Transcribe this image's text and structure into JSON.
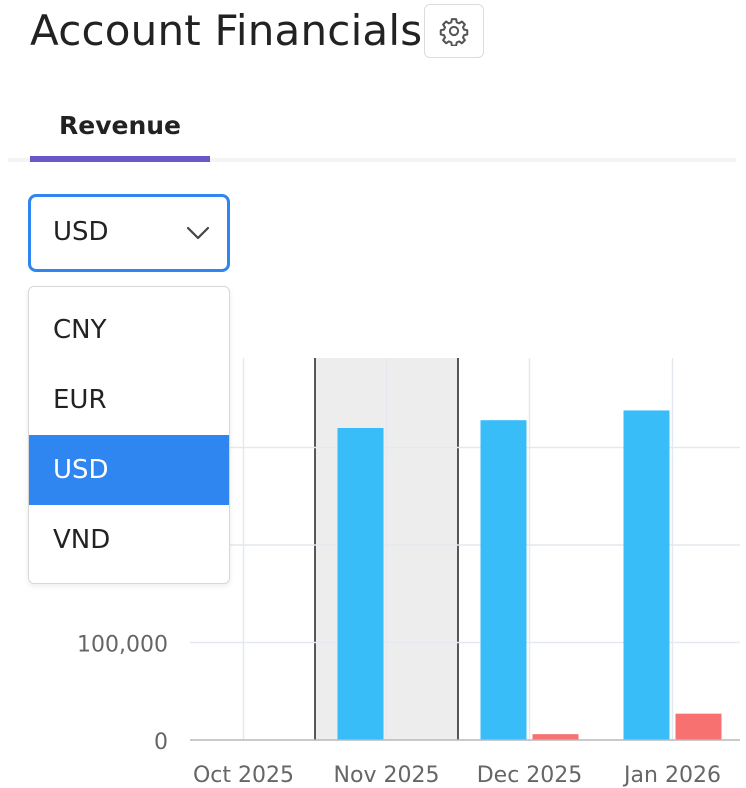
{
  "header": {
    "title": "Account Financials",
    "settings_icon": "gear-icon"
  },
  "tabs": [
    {
      "label": "Revenue",
      "active": true
    }
  ],
  "currency_select": {
    "value": "USD",
    "options": [
      "CNY",
      "EUR",
      "USD",
      "VND"
    ],
    "selected_index": 2
  },
  "colors": {
    "accent": "#6a57c8",
    "focus": "#2f86f0",
    "series_blue": "#38bdf8",
    "series_red": "#f87171"
  },
  "chart_data": {
    "type": "bar",
    "categories": [
      "Oct 2025",
      "Nov 2025",
      "Dec 2025",
      "Jan 2026"
    ],
    "series": [
      {
        "values": [
          0,
          320000,
          328000,
          338000
        ],
        "color": "#38bdf8"
      },
      {
        "values": [
          0,
          0,
          6000,
          27000
        ],
        "color": "#f87171"
      }
    ],
    "y_tick_labels": [
      "0",
      "100,000"
    ],
    "ylim": [
      0,
      400000
    ],
    "grid": true,
    "highlight_category": "Nov 2025"
  }
}
